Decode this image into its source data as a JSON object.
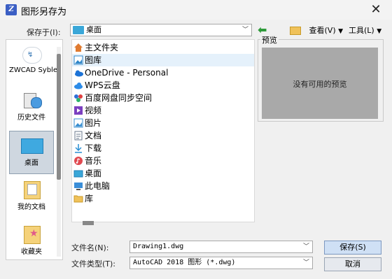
{
  "window": {
    "title": "图形另存为",
    "close_glyph": "✕"
  },
  "toolbar": {
    "save_in_label": "保存于(I):",
    "location_value": "桌面",
    "view_label": "查看(V)",
    "tools_label": "工具(L)"
  },
  "places": [
    {
      "label": "ZWCAD Syble",
      "icon": "cloud-icon"
    },
    {
      "label": "历史文件",
      "icon": "history-icon"
    },
    {
      "label": "桌面",
      "icon": "desktop-icon"
    },
    {
      "label": "我的文档",
      "icon": "documents-icon"
    },
    {
      "label": "收藏夹",
      "icon": "favorites-icon"
    }
  ],
  "files": [
    {
      "name": "主文件夹",
      "icon": "home-icon",
      "color": "#e07b30"
    },
    {
      "name": "图库",
      "icon": "gallery-icon",
      "color": "#2f86c8"
    },
    {
      "name": "OneDrive - Personal",
      "icon": "onedrive-icon",
      "color": "#1d73d6"
    },
    {
      "name": "WPS云盘",
      "icon": "wps-cloud-icon",
      "color": "#2d8ce8"
    },
    {
      "name": "百度网盘同步空间",
      "icon": "baidu-icon",
      "color": "#2e6fd8"
    },
    {
      "name": "视频",
      "icon": "video-icon",
      "color": "#7b3fc0"
    },
    {
      "name": "图片",
      "icon": "pictures-icon",
      "color": "#3a8fd0"
    },
    {
      "name": "文档",
      "icon": "doc-icon",
      "color": "#6b7a8c"
    },
    {
      "name": "下载",
      "icon": "download-icon",
      "color": "#2a8fd4"
    },
    {
      "name": "音乐",
      "icon": "music-icon",
      "color": "#e0484f"
    },
    {
      "name": "桌面",
      "icon": "desktop-icon",
      "color": "#3aa7d8"
    },
    {
      "name": "此电脑",
      "icon": "computer-icon",
      "color": "#3a8ed8"
    },
    {
      "name": "库",
      "icon": "folder-icon",
      "color": "#f0c25a"
    }
  ],
  "preview": {
    "legend": "预览",
    "empty_text": "没有可用的预览"
  },
  "form": {
    "filename_label": "文件名(N):",
    "filename_value": "Drawing1.dwg",
    "filetype_label": "文件类型(T):",
    "filetype_value": "AutoCAD 2018 图形 (*.dwg)"
  },
  "buttons": {
    "save": "保存(S)",
    "cancel": "取消"
  }
}
